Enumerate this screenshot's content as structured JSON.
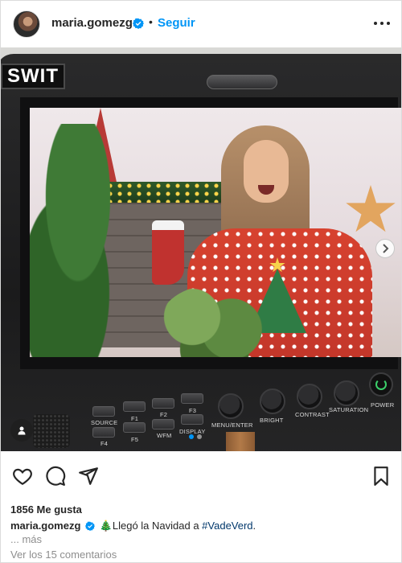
{
  "header": {
    "username": "maria.gomezg",
    "separator": "•",
    "follow_label": "Seguir"
  },
  "photo": {
    "monitor_brand": "SWIT",
    "monitor_buttons": [
      {
        "label": "SOURCE"
      },
      {
        "label": "F1"
      },
      {
        "label": "F2"
      },
      {
        "label": "F3"
      },
      {
        "label": "F4"
      },
      {
        "label": "F5"
      },
      {
        "label": "WFM"
      },
      {
        "label": "DISPLAY"
      }
    ],
    "monitor_knobs": [
      {
        "label": "MENU/ENTER"
      },
      {
        "label": "BRIGHT"
      },
      {
        "label": "CONTRAST"
      },
      {
        "label": "SATURATION"
      },
      {
        "label": "POWER"
      }
    ],
    "carousel_total": 2,
    "carousel_active": 1
  },
  "post": {
    "likes_text": "1856 Me gusta",
    "caption_user": "maria.gomezg",
    "caption_emoji": "🎄",
    "caption_text": "Llegó la Navidad a ",
    "caption_hashtag": "#VadeVerd",
    "caption_end": ".",
    "more_label": "... más",
    "comments_label": "Ver los 15 comentarios"
  },
  "colors": {
    "accent": "#0095f6",
    "text": "#262626",
    "muted": "#8e8e8e",
    "hashtag": "#00376b"
  },
  "icons": {
    "like": "heart-icon",
    "comment": "comment-icon",
    "share": "send-icon",
    "save": "bookmark-icon",
    "more": "more-horizontal-icon",
    "verified": "verified-badge-icon",
    "next": "chevron-right-icon",
    "tag": "user-tag-icon"
  }
}
